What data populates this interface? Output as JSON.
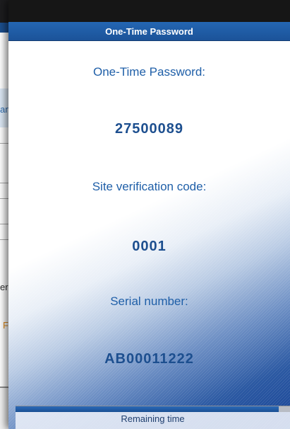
{
  "background_app": {
    "row_text": "an",
    "side_text": "er r",
    "side_orange": "F"
  },
  "otp": {
    "header_title": "One-Time Password",
    "password_label": "One-Time Password:",
    "password_value": "27500089",
    "site_code_label": "Site verification code:",
    "site_code_value": "0001",
    "serial_label": "Serial number:",
    "serial_value": "AB00011222",
    "remaining_label": "Remaining time",
    "remaining_fraction": 0.96
  },
  "colors": {
    "header_blue": "#1f5fa8",
    "label_blue": "#1f5fa8",
    "value_blue": "#1d4f8f",
    "progress_blue": "#1a4f94"
  }
}
